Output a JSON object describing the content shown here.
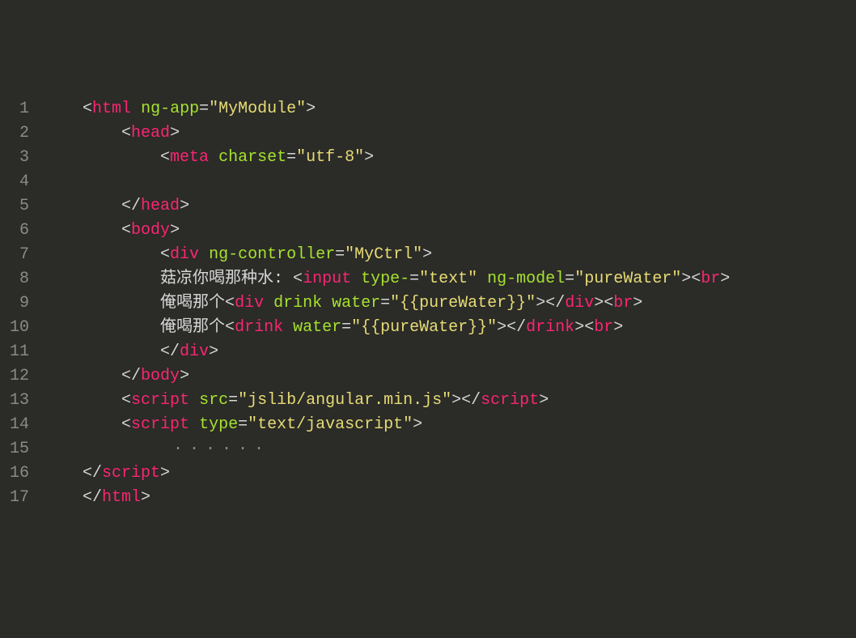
{
  "lines": [
    {
      "n": "1",
      "tokens": [
        {
          "c": "punct",
          "t": "    <"
        },
        {
          "c": "tag",
          "t": "html"
        },
        {
          "c": "punct",
          "t": " "
        },
        {
          "c": "attr",
          "t": "ng-app"
        },
        {
          "c": "punct",
          "t": "="
        },
        {
          "c": "string",
          "t": "\"MyModule\""
        },
        {
          "c": "punct",
          "t": ">"
        }
      ]
    },
    {
      "n": "2",
      "tokens": [
        {
          "c": "punct",
          "t": "        <"
        },
        {
          "c": "tag",
          "t": "head"
        },
        {
          "c": "punct",
          "t": ">"
        }
      ]
    },
    {
      "n": "3",
      "tokens": [
        {
          "c": "punct",
          "t": "            <"
        },
        {
          "c": "tag",
          "t": "meta"
        },
        {
          "c": "punct",
          "t": " "
        },
        {
          "c": "attr",
          "t": "charset"
        },
        {
          "c": "punct",
          "t": "="
        },
        {
          "c": "string",
          "t": "\"utf-8\""
        },
        {
          "c": "punct",
          "t": ">"
        }
      ]
    },
    {
      "n": "4",
      "tokens": [
        {
          "c": "text",
          "t": ""
        }
      ]
    },
    {
      "n": "5",
      "tokens": [
        {
          "c": "punct",
          "t": "        </"
        },
        {
          "c": "tag",
          "t": "head"
        },
        {
          "c": "punct",
          "t": ">"
        }
      ]
    },
    {
      "n": "6",
      "tokens": [
        {
          "c": "punct",
          "t": "        <"
        },
        {
          "c": "tag",
          "t": "body"
        },
        {
          "c": "punct",
          "t": ">"
        }
      ]
    },
    {
      "n": "7",
      "tokens": [
        {
          "c": "punct",
          "t": "            <"
        },
        {
          "c": "tag",
          "t": "div"
        },
        {
          "c": "punct",
          "t": " "
        },
        {
          "c": "attr",
          "t": "ng-controller"
        },
        {
          "c": "punct",
          "t": "="
        },
        {
          "c": "string",
          "t": "\"MyCtrl\""
        },
        {
          "c": "punct",
          "t": ">"
        }
      ]
    },
    {
      "n": "8",
      "tokens": [
        {
          "c": "text",
          "t": "            菇凉你喝那种水: "
        },
        {
          "c": "punct",
          "t": "<"
        },
        {
          "c": "tag",
          "t": "input"
        },
        {
          "c": "punct",
          "t": " "
        },
        {
          "c": "attr",
          "t": "type-"
        },
        {
          "c": "punct",
          "t": "="
        },
        {
          "c": "string",
          "t": "\"text\""
        },
        {
          "c": "punct",
          "t": " "
        },
        {
          "c": "attr",
          "t": "ng-model"
        },
        {
          "c": "punct",
          "t": "="
        },
        {
          "c": "string",
          "t": "\"pureWater\""
        },
        {
          "c": "punct",
          "t": "><"
        },
        {
          "c": "tag",
          "t": "br"
        },
        {
          "c": "punct",
          "t": ">"
        }
      ]
    },
    {
      "n": "9",
      "tokens": [
        {
          "c": "text",
          "t": "            俺喝那个"
        },
        {
          "c": "punct",
          "t": "<"
        },
        {
          "c": "tag",
          "t": "div"
        },
        {
          "c": "punct",
          "t": " "
        },
        {
          "c": "attr",
          "t": "drink"
        },
        {
          "c": "punct",
          "t": " "
        },
        {
          "c": "attr",
          "t": "water"
        },
        {
          "c": "punct",
          "t": "="
        },
        {
          "c": "string",
          "t": "\"{{pureWater}}\""
        },
        {
          "c": "punct",
          "t": "></"
        },
        {
          "c": "tag",
          "t": "div"
        },
        {
          "c": "punct",
          "t": "><"
        },
        {
          "c": "tag",
          "t": "br"
        },
        {
          "c": "punct",
          "t": ">"
        }
      ]
    },
    {
      "n": "10",
      "tokens": [
        {
          "c": "text",
          "t": "            俺喝那个"
        },
        {
          "c": "punct",
          "t": "<"
        },
        {
          "c": "tag",
          "t": "drink"
        },
        {
          "c": "punct",
          "t": " "
        },
        {
          "c": "attr",
          "t": "water"
        },
        {
          "c": "punct",
          "t": "="
        },
        {
          "c": "string",
          "t": "\"{{pureWater}}\""
        },
        {
          "c": "punct",
          "t": "></"
        },
        {
          "c": "tag",
          "t": "drink"
        },
        {
          "c": "punct",
          "t": "><"
        },
        {
          "c": "tag",
          "t": "br"
        },
        {
          "c": "punct",
          "t": ">"
        }
      ]
    },
    {
      "n": "11",
      "tokens": [
        {
          "c": "punct",
          "t": "            </"
        },
        {
          "c": "tag",
          "t": "div"
        },
        {
          "c": "punct",
          "t": ">"
        }
      ]
    },
    {
      "n": "12",
      "tokens": [
        {
          "c": "punct",
          "t": "        </"
        },
        {
          "c": "tag",
          "t": "body"
        },
        {
          "c": "punct",
          "t": ">"
        }
      ]
    },
    {
      "n": "13",
      "tokens": [
        {
          "c": "punct",
          "t": "        <"
        },
        {
          "c": "tag",
          "t": "script"
        },
        {
          "c": "punct",
          "t": " "
        },
        {
          "c": "attr",
          "t": "src"
        },
        {
          "c": "punct",
          "t": "="
        },
        {
          "c": "string",
          "t": "\"jslib/angular.min.js\""
        },
        {
          "c": "punct",
          "t": "></"
        },
        {
          "c": "tag",
          "t": "script"
        },
        {
          "c": "punct",
          "t": ">"
        }
      ]
    },
    {
      "n": "14",
      "tokens": [
        {
          "c": "punct",
          "t": "        <"
        },
        {
          "c": "tag",
          "t": "script"
        },
        {
          "c": "punct",
          "t": " "
        },
        {
          "c": "attr",
          "t": "type"
        },
        {
          "c": "punct",
          "t": "="
        },
        {
          "c": "string",
          "t": "\"text/javascript\""
        },
        {
          "c": "punct",
          "t": ">"
        }
      ]
    },
    {
      "n": "15",
      "tokens": [
        {
          "c": "fold",
          "t": "        ······"
        }
      ]
    },
    {
      "n": "16",
      "tokens": [
        {
          "c": "punct",
          "t": "    </"
        },
        {
          "c": "tag",
          "t": "script"
        },
        {
          "c": "punct",
          "t": ">"
        }
      ]
    },
    {
      "n": "17",
      "tokens": [
        {
          "c": "punct",
          "t": "    </"
        },
        {
          "c": "tag",
          "t": "html"
        },
        {
          "c": "punct",
          "t": ">"
        }
      ]
    }
  ]
}
